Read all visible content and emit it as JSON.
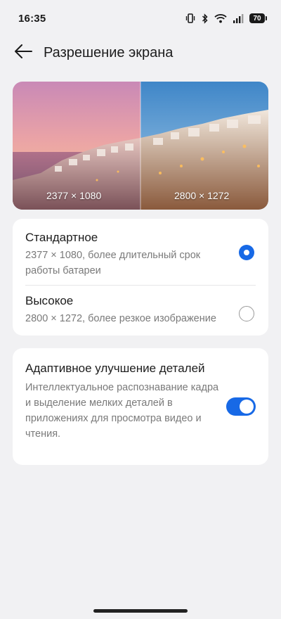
{
  "status_bar": {
    "time": "16:35",
    "battery_level": "70",
    "icons": [
      "vibrate-icon",
      "bluetooth-icon",
      "wifi-icon",
      "signal-icon",
      "battery-icon"
    ]
  },
  "header": {
    "title": "Разрешение экрана",
    "back_icon": "arrow-left-icon"
  },
  "preview": {
    "left_label": "2377 × 1080",
    "right_label": "2800 × 1272"
  },
  "resolution_options": [
    {
      "title": "Стандартное",
      "description": "2377 × 1080, более длительный срок работы батареи",
      "selected": true
    },
    {
      "title": "Высокое",
      "description": "2800 × 1272, более резкое изображение",
      "selected": false
    }
  ],
  "adaptive": {
    "title": "Адаптивное улучшение деталей",
    "description": "Интеллектуальное распознавание кадра и выделение мелких деталей в приложениях для просмотра видео и чтения.",
    "enabled": true
  },
  "colors": {
    "accent": "#1769e6",
    "background": "#f1f1f3",
    "card": "#ffffff"
  }
}
